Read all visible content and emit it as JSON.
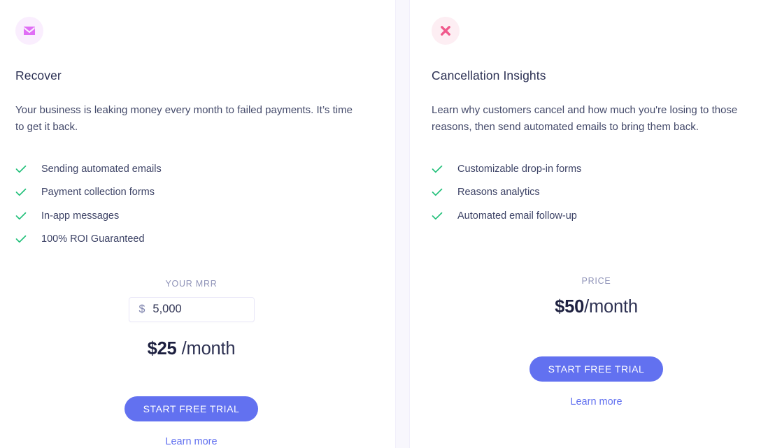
{
  "colors": {
    "accent": "#6271f0",
    "check": "#22c07a",
    "mail_icon": "#e06ef5",
    "mail_badge_bg": "#faeefe",
    "cross_icon": "#f0598c",
    "cross_badge_bg": "#fdeef3",
    "heading": "#2c3154",
    "body_text": "#454b6b",
    "muted_label": "#8f93b8",
    "divider": "#f8f7fd"
  },
  "plans": [
    {
      "icon_name": "mail-icon",
      "title": "Recover",
      "description": "Your business is leaking money every month to failed payments. It’s time to get it back.",
      "features": [
        "Sending automated emails",
        "Payment collection forms",
        "In-app messages",
        "100% ROI Guaranteed"
      ],
      "price_caption": "YOUR MRR",
      "input": {
        "currency_symbol": "$",
        "value": "5,000",
        "placeholder": "0"
      },
      "price_amount": "$25",
      "price_period": "/month",
      "cta_label": "START FREE TRIAL",
      "learn_more_label": "Learn more"
    },
    {
      "icon_name": "cross-icon",
      "title": "Cancellation Insights",
      "description": "Learn why customers cancel and how much you're losing to those reasons, then send automated emails to bring them back.",
      "features": [
        "Customizable drop-in forms",
        "Reasons analytics",
        "Automated email follow-up"
      ],
      "price_caption": "PRICE",
      "price_amount": "$50",
      "price_period": "/month",
      "cta_label": "START FREE TRIAL",
      "learn_more_label": "Learn more"
    }
  ]
}
